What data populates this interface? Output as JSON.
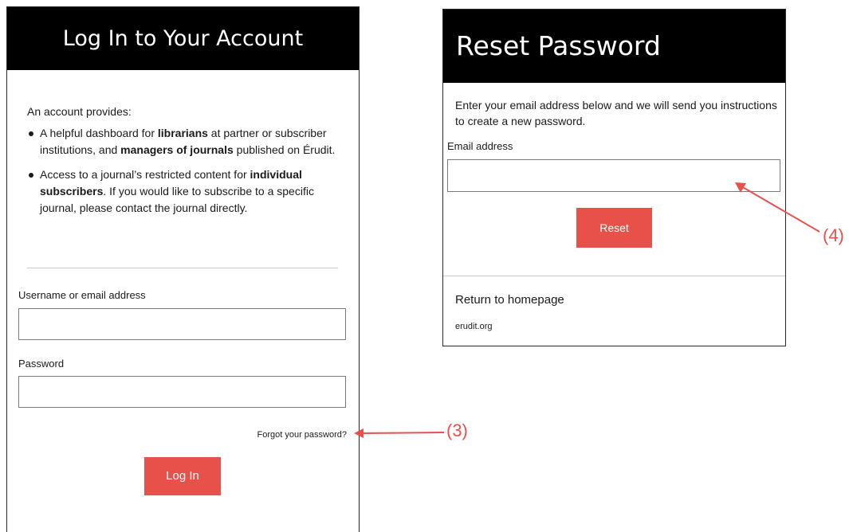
{
  "login": {
    "title": "Log In to Your Account",
    "intro": "An account provides:",
    "benefits": [
      {
        "p1": "A helpful dashboard for ",
        "b1": "librarians",
        "p2": " at partner or subscriber institutions, and ",
        "b2": "managers of journals",
        "p3": " published on Érudit."
      },
      {
        "p1": "Access to a journal’s restricted content for ",
        "b1": "individual subscribers",
        "p2": ". If you would like to subscribe to a specific journal, please contact the journal directly."
      }
    ],
    "username_label": "Username or email address",
    "username_value": "",
    "password_label": "Password",
    "password_value": "",
    "forgot_link": "Forgot your password?",
    "login_button": "Log In"
  },
  "reset": {
    "title": "Reset Password",
    "instructions": "Enter your email address below and we will send you instructions to create a new password.",
    "email_label": "Email address",
    "email_value": "",
    "reset_button": "Reset",
    "return_link": "Return to homepage",
    "site_link": "erudit.org"
  },
  "annotations": {
    "forgot_callout": "(3)",
    "email_callout": "(4)",
    "color": "#e8504a"
  },
  "colors": {
    "header_bg": "#000000",
    "button_bg": "#e8504a"
  }
}
